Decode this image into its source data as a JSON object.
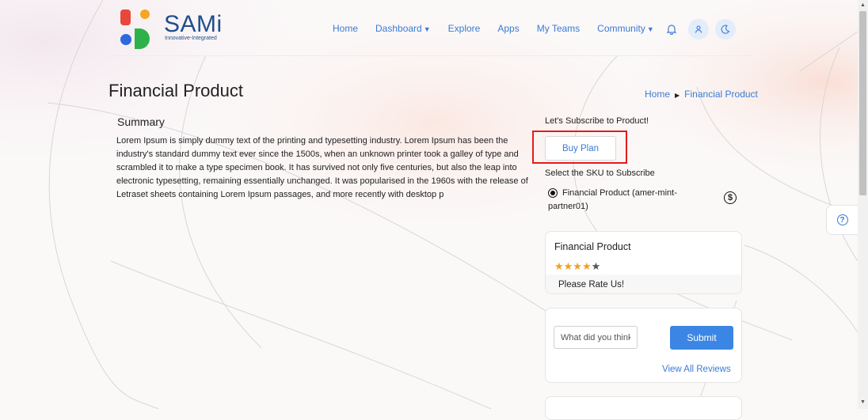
{
  "brand": {
    "name": "SAMi",
    "tagline": "Innovative-Integrated",
    "colors": {
      "orange": "#f5a623",
      "red": "#e8483b",
      "blue": "#2d6ae0",
      "green": "#2fb14a"
    }
  },
  "nav": {
    "home": "Home",
    "dashboard": "Dashboard",
    "explore": "Explore",
    "apps": "Apps",
    "my_teams": "My Teams",
    "community": "Community",
    "icons": [
      "bell-icon",
      "user-icon",
      "moon-icon"
    ]
  },
  "page": {
    "title": "Financial Product"
  },
  "breadcrumb": {
    "home": "Home",
    "current": "Financial Product"
  },
  "summary": {
    "title": "Summary",
    "text": "Lorem Ipsum is simply dummy text of the printing and typesetting industry. Lorem Ipsum has been the industry's standard dummy text ever since the 1500s, when an unknown printer took a galley of type and scrambled it to make a type specimen book. It has survived not only five centuries, but also the leap into electronic typesetting, remaining essentially unchanged. It was popularised in the 1960s with the release of Letraset sheets containing Lorem Ipsum passages, and more recently with desktop p"
  },
  "subscribe": {
    "label": "Let's Subscribe to Product!",
    "buy_button": "Buy Plan",
    "sku_label": "Select the SKU to Subscribe",
    "sku_option": "Financial Product (amer-mint-partner01)",
    "sku_selected": true,
    "dollar_symbol": "$"
  },
  "rating_card": {
    "title": "Financial Product",
    "rating": 4,
    "max_rating": 5,
    "star_on": "★★★★",
    "star_off": "★",
    "rate_prompt": "Please Rate Us!"
  },
  "review": {
    "placeholder": "What did you think?",
    "submit": "Submit",
    "view_all": "View All Reviews"
  },
  "help": {
    "symbol": "?"
  },
  "accent_color": "#3b86e4",
  "highlight_color": "#e41b1b"
}
